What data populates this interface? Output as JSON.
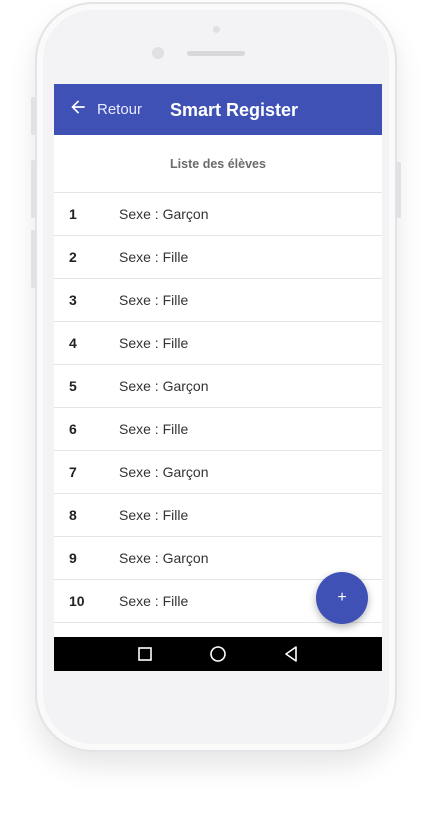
{
  "appbar": {
    "back_label": "Retour",
    "title": "Smart Register",
    "color": "#3f51b5"
  },
  "list": {
    "header": "Liste des élèves",
    "rows": [
      {
        "num": "1",
        "sex": "Sexe : Garçon"
      },
      {
        "num": "2",
        "sex": "Sexe : Fille"
      },
      {
        "num": "3",
        "sex": "Sexe : Fille"
      },
      {
        "num": "4",
        "sex": "Sexe : Fille"
      },
      {
        "num": "5",
        "sex": "Sexe : Garçon"
      },
      {
        "num": "6",
        "sex": "Sexe : Fille"
      },
      {
        "num": "7",
        "sex": "Sexe : Garçon"
      },
      {
        "num": "8",
        "sex": "Sexe : Fille"
      },
      {
        "num": "9",
        "sex": "Sexe : Garçon"
      },
      {
        "num": "10",
        "sex": "Sexe : Fille"
      }
    ]
  },
  "fab": {
    "label": "+",
    "icon": "plus-icon"
  },
  "navbar": {
    "icons": [
      "recents-square-icon",
      "home-circle-icon",
      "back-triangle-icon"
    ]
  }
}
